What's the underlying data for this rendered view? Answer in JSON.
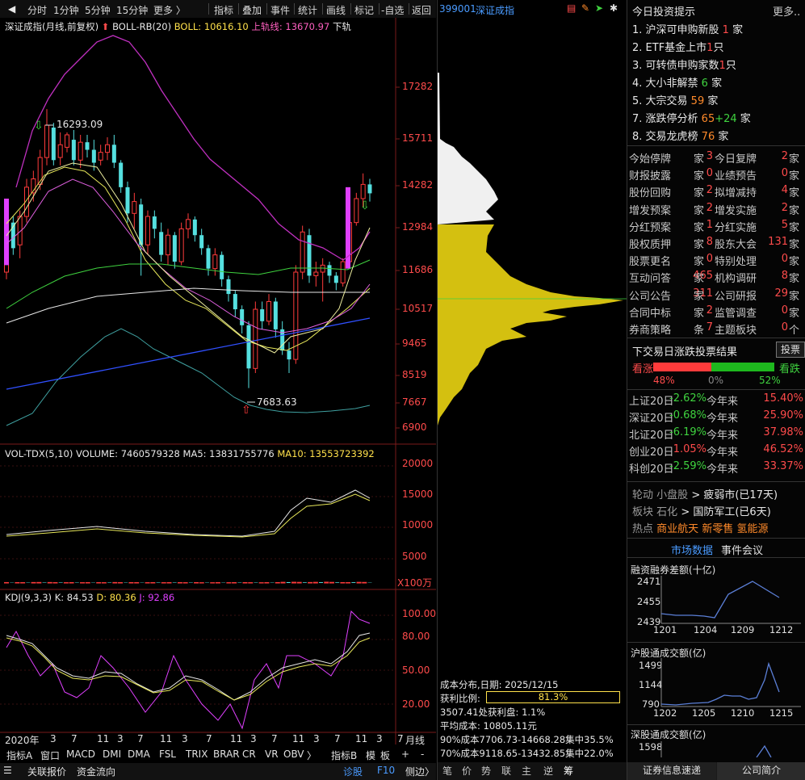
{
  "toolbar": {
    "items": [
      "分时",
      "1分钟",
      "5分钟",
      "15分钟",
      "更多 〉",
      "指标",
      "叠加",
      "事件",
      "统计",
      "画线",
      "标记",
      "-自选",
      "返回"
    ]
  },
  "chart_header": {
    "name": "深证成指(月线,前复权)",
    "boll_name": "BOLL-RB(20)",
    "boll_label": "BOLL: 10616.10",
    "upper_label": "上轨线: 13670.97",
    "lower_label": "下轨"
  },
  "price_axis": [
    "17282",
    "15711",
    "14282",
    "12984",
    "11686",
    "10517",
    "9465",
    "8519",
    "7667",
    "6900"
  ],
  "annotations": {
    "high": "16293.09",
    "low": "7683.63"
  },
  "volume_header": {
    "name": "VOL-TDX(5,10)",
    "volume": "VOLUME: 7460579328",
    "ma5": "MA5: 13831755776",
    "ma10": "MA10: 13553723392"
  },
  "volume_axis": [
    "20000",
    "15000",
    "10000",
    "5000"
  ],
  "volume_unit": "X100万",
  "kdj_header": {
    "name": "KDJ(9,3,3)",
    "k": "K: 84.53",
    "d": "D: 80.36",
    "j": "J: 92.86"
  },
  "kdj_axis": [
    "100.00",
    "80.00",
    "50.00",
    "20.00"
  ],
  "time_axis": {
    "labels": [
      "2020年",
      "3",
      "7",
      "11",
      "3",
      "7",
      "11",
      "3",
      "7",
      "11",
      "3",
      "7",
      "11",
      "3",
      "7",
      "11",
      "3",
      "7",
      "11"
    ],
    "period": "月线"
  },
  "indicator_tabs": [
    "指标A",
    "窗口",
    "MACD",
    "DMI",
    "DMA",
    "FSL",
    "TRIX",
    "BRAR",
    "CR",
    "VR",
    "OBV",
    "〉",
    "指标B",
    "模",
    "板",
    "+",
    "-"
  ],
  "status_bar": {
    "quote": "关联报价",
    "flow": "资金流向",
    "diagnose": "诊股",
    "f10": "F10",
    "side": "侧边〉"
  },
  "cost_panel": {
    "code": "399001",
    "name": "深证成指",
    "date_line": "成本分布,日期:  2025/12/15",
    "profit_label": "获利比例:",
    "profit_pct": "81.3%",
    "profit_ratio": 0.813,
    "profit_line": "3507.41处获利盘:  1.1%",
    "avg_cost": "平均成本:  10805.11元",
    "band90": "90%成本7706.73-14668.28集中35.5%",
    "band70": "70%成本9118.65-13432.85集中22.0%",
    "tabs": [
      "笔",
      "价",
      "势",
      "联",
      "主",
      "逆",
      "筹"
    ]
  },
  "right_panel": {
    "title": "今日投资提示",
    "more": "更多..",
    "tips": [
      {
        "text": "1. 沪深可申购新股 ",
        "num": "1",
        "unit": " 家",
        "color": "#ff4b4b"
      },
      {
        "text": "2. ETF基金上市",
        "num": "1",
        "unit": "只",
        "color": "#ff4b4b"
      },
      {
        "text": "3. 可转债申购家数",
        "num": "1",
        "unit": "只",
        "color": "#ff4b4b"
      },
      {
        "text": "4. 大小非解禁 ",
        "num": "6",
        "unit": " 家",
        "color": "#3fd33f"
      },
      {
        "text": "5. 大宗交易 ",
        "num": "59",
        "unit": " 家",
        "color": "#ff8a2a"
      },
      {
        "text": "7. 涨跌停分析 ",
        "num": "65",
        "num2": "+24",
        "unit": " 家",
        "color": "#ff8a2a",
        "color2": "#3fd33f"
      },
      {
        "text": "8. 交易龙虎榜 ",
        "num": "76",
        "unit": " 家",
        "color": "#ff8a2a"
      }
    ],
    "stats": [
      [
        "今始停牌",
        "3",
        "家",
        "今日复牌",
        "2",
        "家"
      ],
      [
        "财报披露",
        "0",
        "家",
        "业绩预告",
        "0",
        "家"
      ],
      [
        "股份回购",
        "2",
        "家",
        "拟增减持",
        "4",
        "家"
      ],
      [
        "增发预案",
        "2",
        "家",
        "增发实施",
        "2",
        "家"
      ],
      [
        "分红预案",
        "1",
        "家",
        "分红实施",
        "5",
        "家"
      ],
      [
        "股权质押",
        "8",
        "家",
        "股东大会",
        "131",
        "家"
      ],
      [
        "股票更名",
        "0",
        "家",
        "特别处理",
        "0",
        "家"
      ],
      [
        "互动问答",
        "465",
        "家",
        "机构调研",
        "8",
        "家"
      ],
      [
        "公司公告",
        "311",
        "家",
        "公司研报",
        "29",
        "家"
      ],
      [
        "合同中标",
        "2",
        "家",
        "监管调查",
        "0",
        "家"
      ],
      [
        "券商策略",
        "7",
        "条",
        "主题板块",
        "0",
        "个"
      ]
    ],
    "vote_title": "下交易日涨跌投票结果",
    "vote_button": "投票",
    "vote_up_label": "看涨",
    "vote_down_label": "看跌",
    "vote_up": "48%",
    "vote_flat": "0%",
    "vote_down": "52%",
    "vote_up_ratio": 0.48,
    "indices": [
      {
        "name": "上证20日",
        "chg": "-2.62%",
        "ytd_label": "今年来",
        "ytd": "15.40%"
      },
      {
        "name": "深证20日",
        "chg": "-0.68%",
        "ytd_label": "今年来",
        "ytd": "25.90%"
      },
      {
        "name": "北证20日",
        "chg": "-6.19%",
        "ytd_label": "今年来",
        "ytd": "37.98%"
      },
      {
        "name": "创业20日",
        "chg": "1.05%",
        "ytd_label": "今年来",
        "ytd": "46.52%"
      },
      {
        "name": "科创20日",
        "chg": "-2.59%",
        "ytd_label": "今年来",
        "ytd": "33.37%"
      }
    ],
    "rotation": {
      "label": "轮动",
      "value": "小盘股",
      "arrow": ">",
      "result": "疲弱市(已17天)"
    },
    "sector": {
      "label": "板块",
      "value": "石化",
      "arrow": ">",
      "result": "国防军工(已6天)"
    },
    "hot": {
      "label": "热点",
      "items": [
        "商业航天",
        "新零售",
        "氢能源"
      ]
    },
    "tabs": [
      "市场数据",
      "事件会议"
    ],
    "margin_title": "融资融券差额(十亿)",
    "margin_y": [
      "2471",
      "2455",
      "2439"
    ],
    "margin_x": [
      "1201",
      "1204",
      "1209",
      "1212"
    ],
    "sh_title": "沪股通成交额(亿)",
    "sh_y": [
      "1499",
      "1144",
      "790"
    ],
    "sh_x": [
      "1202",
      "1205",
      "1210",
      "1215"
    ],
    "sz_title": "深股通成交额(亿)",
    "sz_y": [
      "1598"
    ],
    "bottom_tabs": [
      "证券信息速递",
      "公司简介"
    ]
  }
}
